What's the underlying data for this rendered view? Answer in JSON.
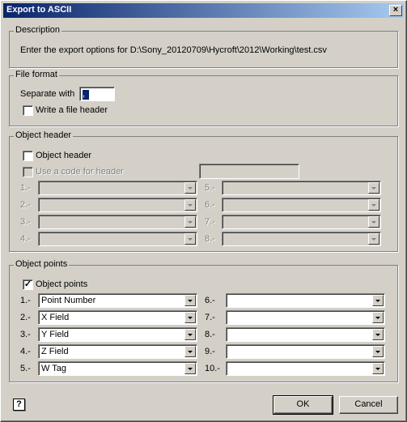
{
  "window": {
    "title": "Export to ASCII",
    "close_glyph": "×"
  },
  "description": {
    "legend": "Description",
    "text": "Enter the export options for D:\\Sony_20120709\\Hycroft\\2012\\Working\\test.csv"
  },
  "file_format": {
    "legend": "File format",
    "separate_label": "Separate with",
    "separator_value": ",",
    "file_header_label": "Write a file header",
    "file_header_checked": false
  },
  "object_header": {
    "legend": "Object header",
    "checkbox_label": "Object header",
    "checked": false,
    "code_label": "Use a code for header",
    "code_value": "",
    "fields": [
      {
        "label": "1.-",
        "value": ""
      },
      {
        "label": "2.-",
        "value": ""
      },
      {
        "label": "3.-",
        "value": ""
      },
      {
        "label": "4.-",
        "value": ""
      },
      {
        "label": "5.-",
        "value": ""
      },
      {
        "label": "6.-",
        "value": ""
      },
      {
        "label": "7.-",
        "value": ""
      },
      {
        "label": "8.-",
        "value": ""
      }
    ]
  },
  "object_points": {
    "legend": "Object points",
    "checkbox_label": "Object points",
    "checked": true,
    "check_glyph": "✓",
    "fields": [
      {
        "label": "1.-",
        "value": "Point Number"
      },
      {
        "label": "2.-",
        "value": "X Field"
      },
      {
        "label": "3.-",
        "value": "Y Field"
      },
      {
        "label": "4.-",
        "value": "Z Field"
      },
      {
        "label": "5.-",
        "value": "W Tag"
      },
      {
        "label": "6.-",
        "value": ""
      },
      {
        "label": "7.-",
        "value": ""
      },
      {
        "label": "8.-",
        "value": ""
      },
      {
        "label": "9.-",
        "value": ""
      },
      {
        "label": "10.-",
        "value": ""
      }
    ]
  },
  "footer": {
    "help_glyph": "?",
    "ok_label": "OK",
    "cancel_label": "Cancel"
  },
  "icons": {
    "help": "help-icon",
    "close": "close-icon",
    "dropdown": "chevron-down-icon"
  }
}
